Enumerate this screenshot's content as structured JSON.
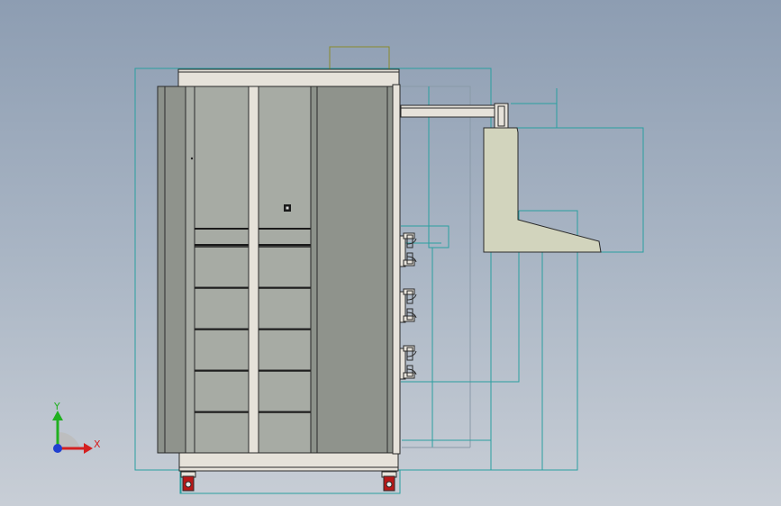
{
  "viewport": {
    "background_top": "#8d9db2",
    "background_bottom": "#c8ced6"
  },
  "triad": {
    "x_label": "X",
    "y_label": "Y",
    "x_color": "#d42020",
    "y_color": "#20b020",
    "z_color": "#2040d0"
  },
  "colors": {
    "frame": "#e6e2da",
    "panel": "#a7aba4",
    "panel_dark": "#8c918a",
    "edge": "#2a2a2a",
    "sketch_line": "#2a9fa0",
    "sketch_line_gray": "#8a9aa8",
    "olive_sketch": "#8a8a2a",
    "bracket": "#d2d4bd",
    "caster_wheel": "#b81818"
  },
  "model": {
    "name": "cabinet-side-view",
    "left_drawer_count": 5,
    "right_drawer_count": 5,
    "hinge_count": 3,
    "caster_count": 2
  }
}
